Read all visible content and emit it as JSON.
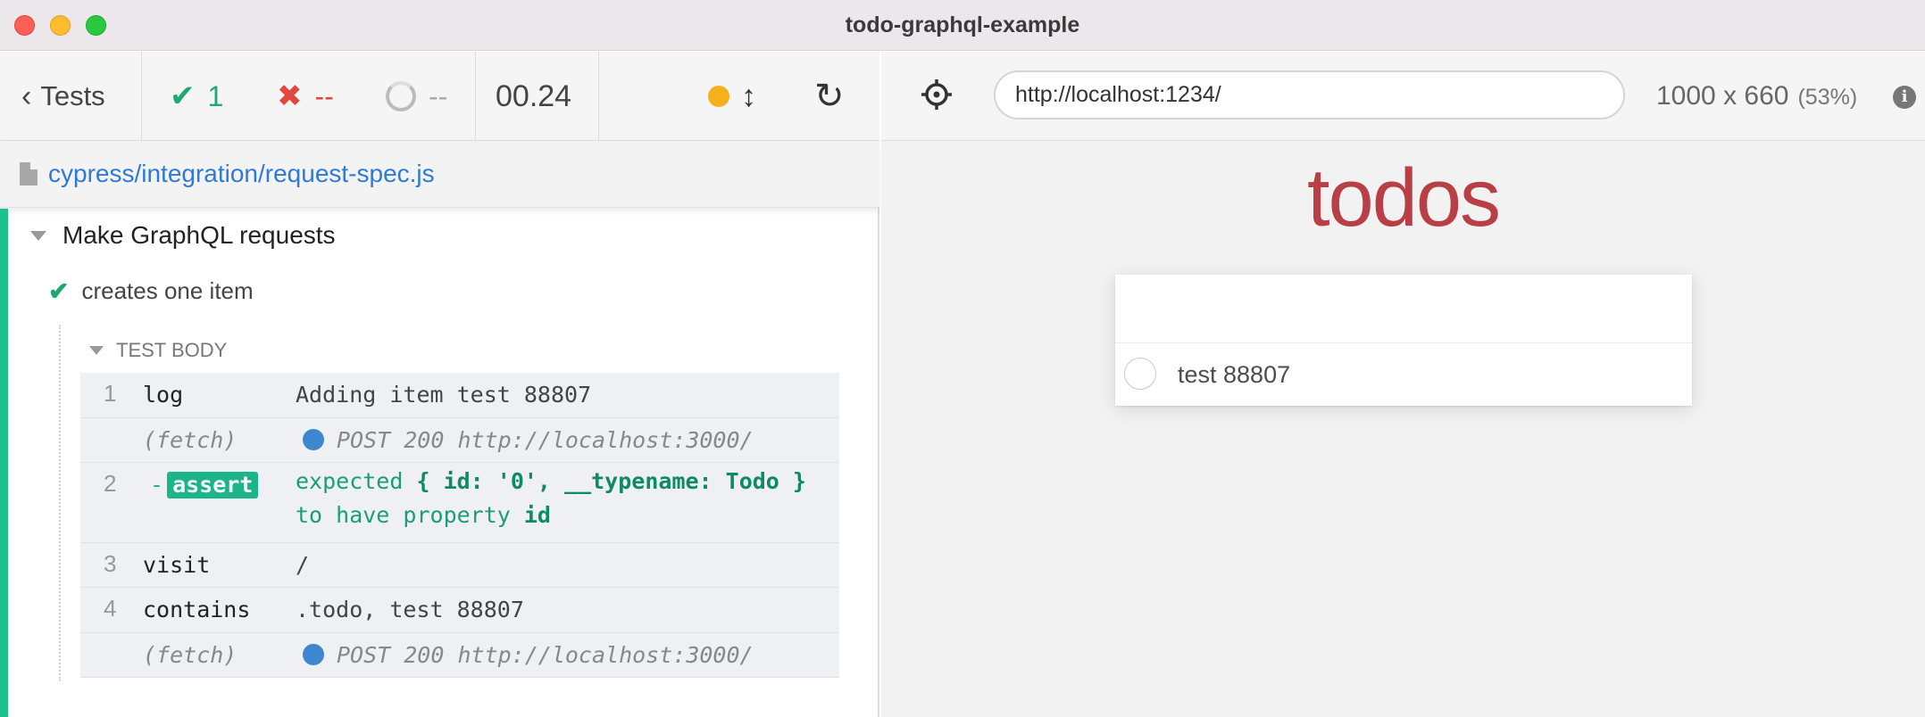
{
  "window": {
    "title": "todo-graphql-example"
  },
  "reporter": {
    "tests_label": "Tests",
    "passed": "1",
    "failed": "--",
    "pending": "--",
    "duration": "00.24",
    "spec_path": "cypress/integration/request-spec.js",
    "suite_title": "Make GraphQL requests",
    "test_title": "creates one item",
    "test_body_label": "TEST BODY",
    "commands": [
      {
        "num": "1",
        "name": "log",
        "message": "Adding item test 88807"
      },
      {
        "num": "",
        "name": "(fetch)",
        "message": "POST 200 http://localhost:3000/"
      },
      {
        "num": "2",
        "name": "assert",
        "dash": "-",
        "message_prefix": "expected ",
        "message_obj": "{ id: '0', __typename: Todo }",
        "message_mid": " to have property ",
        "message_prop": "id"
      },
      {
        "num": "3",
        "name": "visit",
        "message": "/"
      },
      {
        "num": "4",
        "name": "contains",
        "message": ".todo, test 88807"
      },
      {
        "num": "",
        "name": "(fetch)",
        "message": "POST 200 http://localhost:3000/"
      }
    ],
    "colors": {
      "pass": "#1fa971",
      "fail": "#e0483e",
      "link": "#2f7ad8",
      "rail": "#1cc28b"
    }
  },
  "aut": {
    "url": "http://localhost:1234/",
    "viewport": "1000 x 660",
    "scale": "(53%)",
    "app": {
      "title": "todos",
      "items": [
        {
          "label": "test 88807",
          "completed": false
        }
      ],
      "title_color": "#b83f45"
    }
  }
}
